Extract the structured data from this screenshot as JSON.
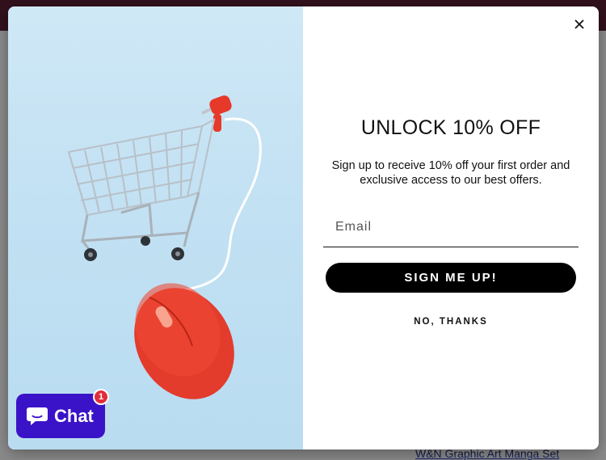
{
  "background": {
    "product_link": "W&N Graphic Art Manga Set"
  },
  "popup": {
    "title": "UNLOCK 10% OFF",
    "subtitle": "Sign up to receive 10% off your first order and exclusive access to our best offers.",
    "email_placeholder": "Email",
    "email_value": "",
    "signup_label": "SIGN ME UP!",
    "decline_label": "NO, THANKS",
    "close_icon": "close-icon",
    "image_icon": "shopping-cart-mouse-image"
  },
  "chat": {
    "label": "Chat",
    "badge_count": "1",
    "icon": "chat-bubble-icon"
  },
  "colors": {
    "topbar": "#5b1f35",
    "chat_button": "#3a13c8",
    "badge": "#e02d3c",
    "signup_button": "#000000",
    "image_background": "#c2e1f3"
  }
}
